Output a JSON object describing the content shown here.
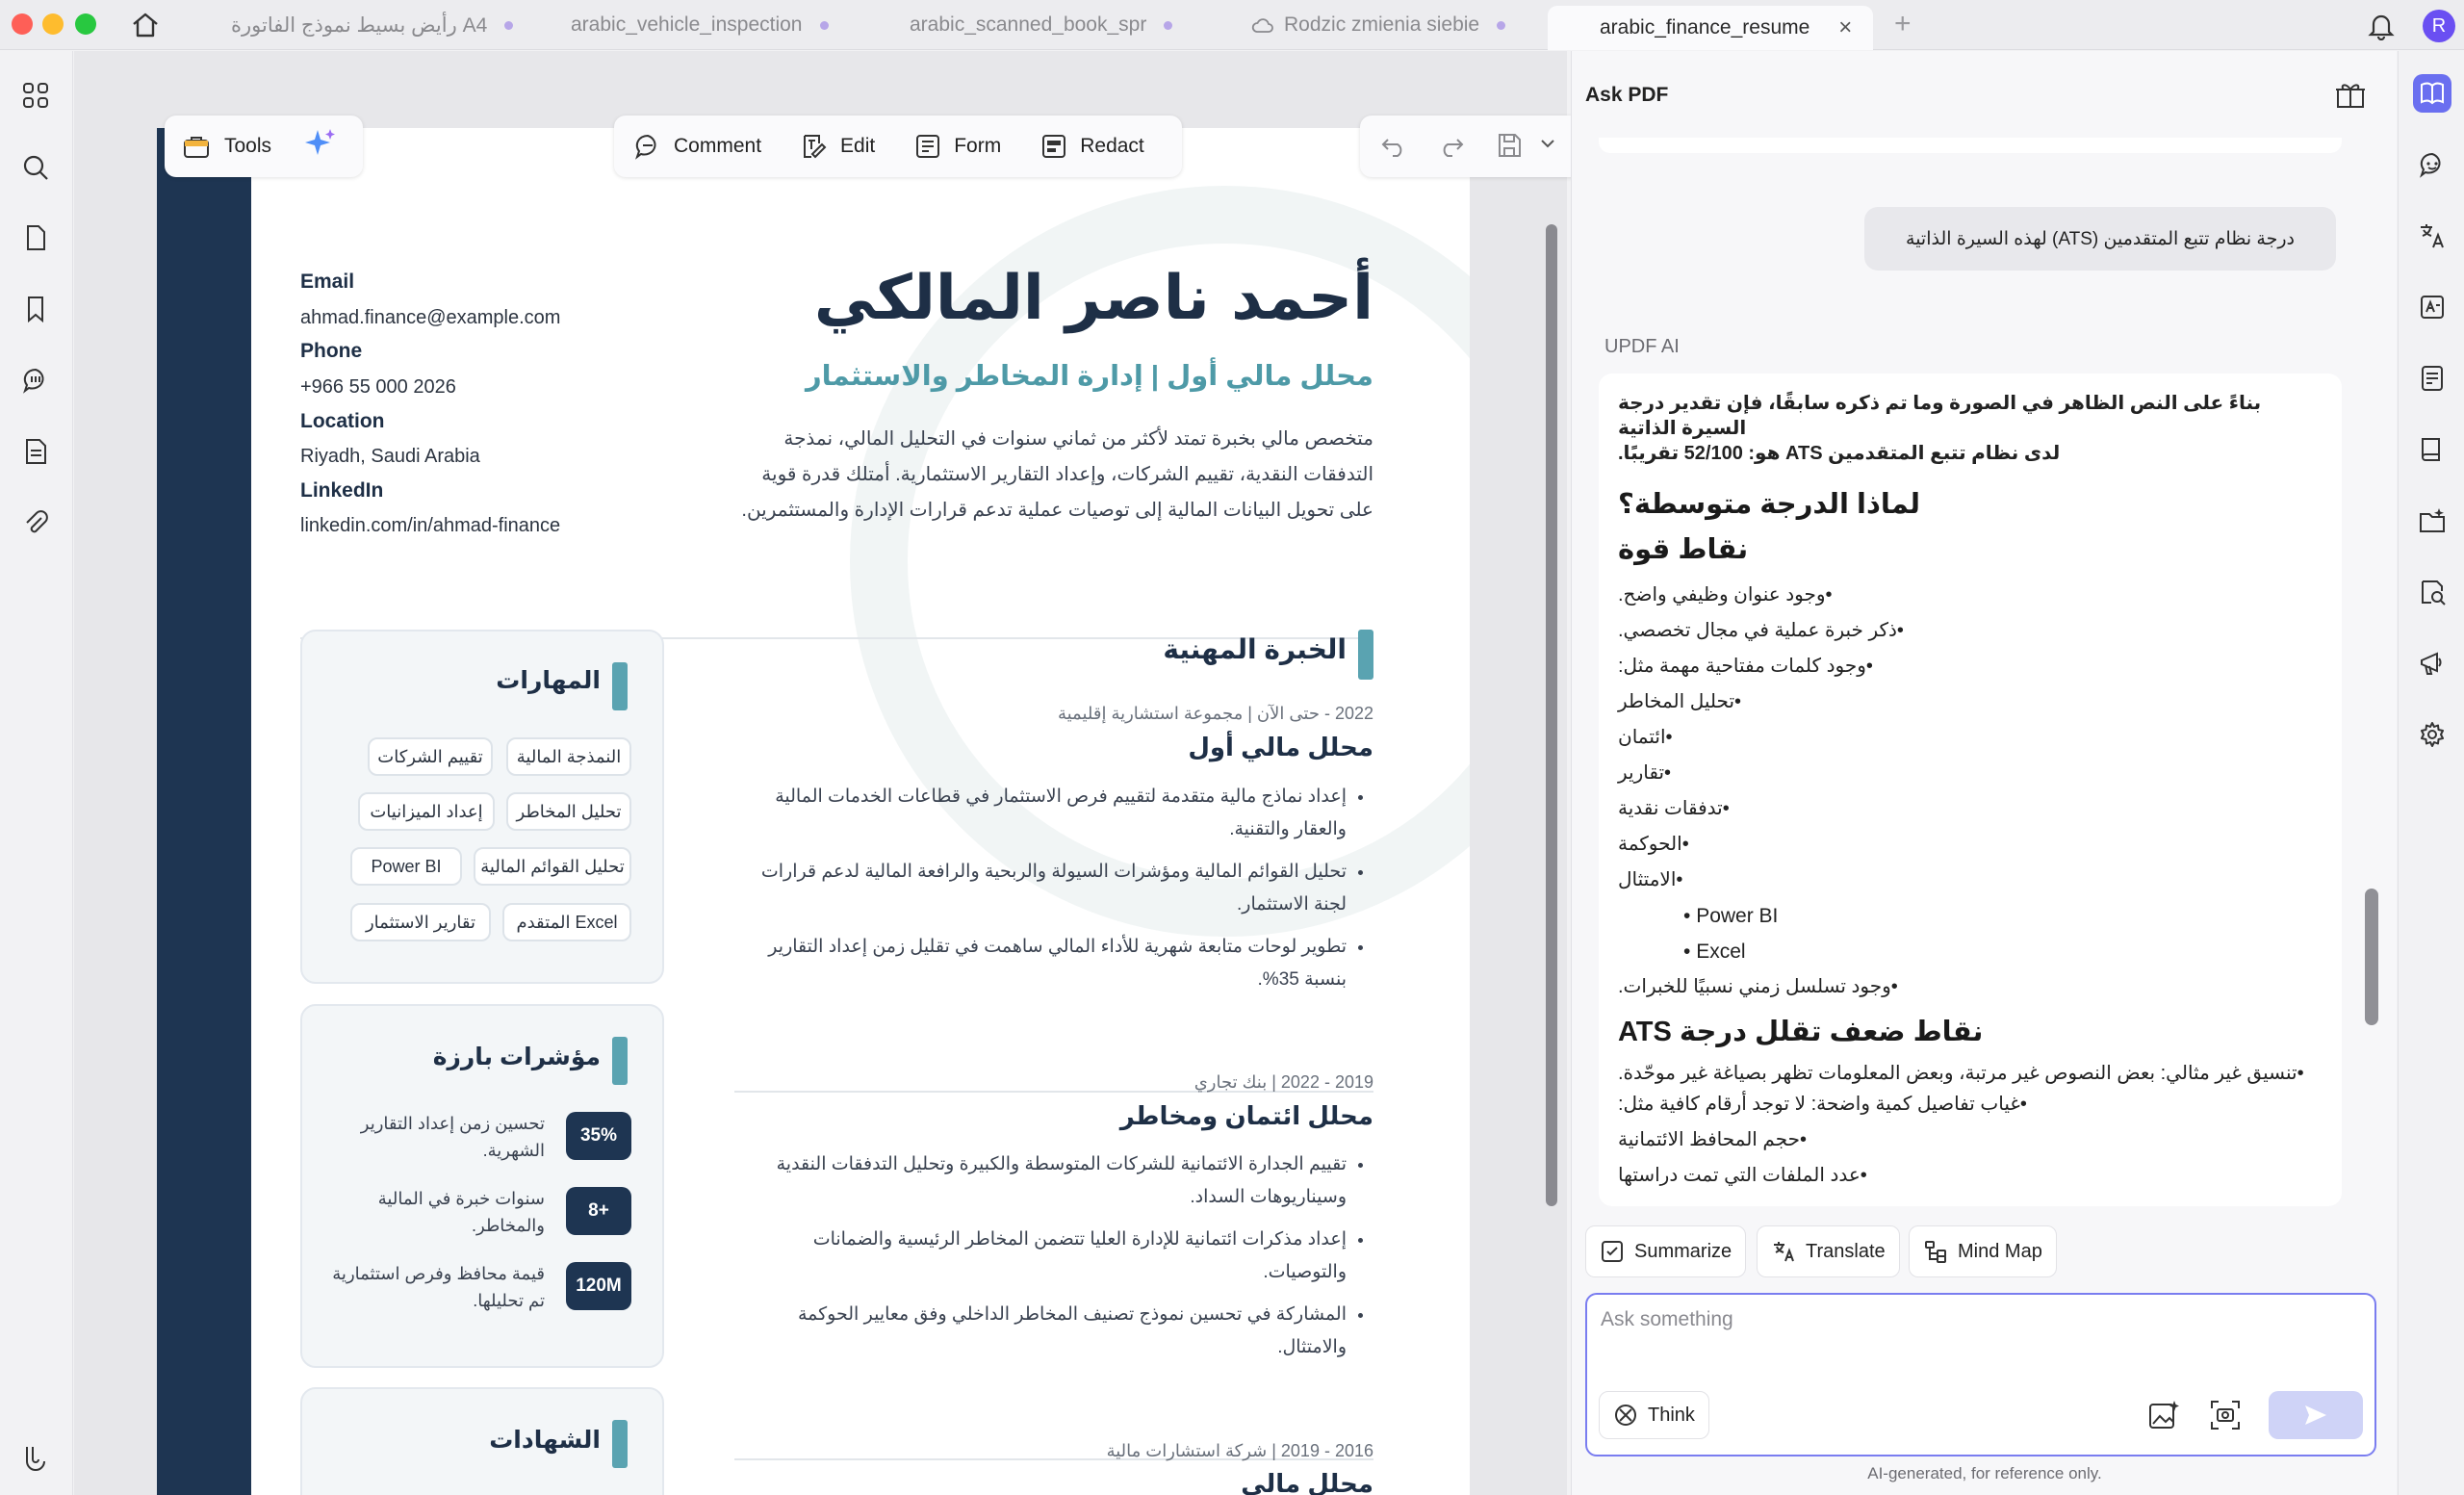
{
  "tabs": [
    {
      "label": "رأيض بسيط نموذج الفاتورة A4",
      "active": false
    },
    {
      "label": "arabic_vehicle_inspection",
      "active": false
    },
    {
      "label": "arabic_scanned_book_spr",
      "active": false
    },
    {
      "label": "Rodzic zmienia siebie",
      "active": false
    },
    {
      "label": "arabic_finance_resume",
      "active": true
    }
  ],
  "user_initial": "R",
  "toolbar": {
    "tools": "Tools",
    "comment": "Comment",
    "edit": "Edit",
    "form": "Form",
    "redact": "Redact"
  },
  "resume": {
    "contact": {
      "email_label": "Email",
      "email": "ahmad.finance@example.com",
      "phone_label": "Phone",
      "phone": "+966 55 000 2026",
      "location_label": "Location",
      "location": "Riyadh, Saudi Arabia",
      "linkedin_label": "LinkedIn",
      "linkedin": "linkedin.com/in/ahmad-finance"
    },
    "name": "أحمد ناصر المالكي",
    "subtitle": "محلل مالي أول | إدارة المخاطر والاستثمار",
    "summary": [
      "متخصص مالي بخبرة تمتد لأكثر من ثماني سنوات في التحليل المالي، نمذجة",
      "التدفقات النقدية، تقييم الشركات، وإعداد التقارير الاستثمارية. أمتلك قدرة قوية",
      "على تحويل البيانات المالية إلى توصيات عملية تدعم قرارات الإدارة والمستثمرين."
    ],
    "experience_title": "الخبرة المهنية",
    "jobs": [
      {
        "meta": "2022 - حتى الآن | مجموعة استشارية إقليمية",
        "title": "محلل مالي أول",
        "bullets": [
          "إعداد نماذج مالية متقدمة لتقييم فرص الاستثمار في قطاعات الخدمات المالية والعقار والتقنية.",
          "تحليل القوائم المالية ومؤشرات السيولة والربحية والرافعة المالية لدعم قرارات لجنة الاستثمار.",
          "تطوير لوحات متابعة شهرية للأداء المالي ساهمت في تقليل زمن إعداد التقارير بنسبة 35%."
        ]
      },
      {
        "meta": "2019 - 2022 | بنك تجاري",
        "title": "محلل ائتمان ومخاطر",
        "bullets": [
          "تقييم الجدارة الائتمانية للشركات المتوسطة والكبيرة وتحليل التدفقات النقدية وسيناريوهات السداد.",
          "إعداد مذكرات ائتمانية للإدارة العليا تتضمن المخاطر الرئيسية والضمانات والتوصيات.",
          "المشاركة في تحسين نموذج تصنيف المخاطر الداخلي وفق معايير الحوكمة والامتثال."
        ]
      },
      {
        "meta": "2016 - 2019 | شركة استشارات مالية",
        "title": "محلل مالي",
        "bullets": []
      }
    ],
    "skills_title": "المهارات",
    "skills": [
      "النمذجة المالية",
      "تقييم الشركات",
      "تحليل المخاطر",
      "إعداد الميزانيات",
      "تحليل القوائم المالية",
      "Power BI",
      "Excel المتقدم",
      "تقارير الاستثمار"
    ],
    "metrics_title": "مؤشرات بارزة",
    "metrics": [
      {
        "value": "35%",
        "label": "تحسين زمن إعداد التقارير الشهرية."
      },
      {
        "value": "8+",
        "label": "سنوات خبرة في المالية والمخاطر."
      },
      {
        "value": "120M",
        "label": "قيمة محافظ وفرص استثمارية تم تحليلها."
      }
    ],
    "certs_title": "الشهادات"
  },
  "ask_pdf": {
    "title": "Ask PDF",
    "user_message": "درجة نظام تتبع المتقدمين (ATS) لهذه السيرة الذاتية",
    "ai_label": "UPDF AI",
    "intro_line1": "بناءً على النص الظاهر في الصورة وما تم ذكره سابقًا، فإن تقدير درجة السيرة الذاتية",
    "intro_line2": "لدى نظام تتبع المتقدمين ATS هو: 52/100 تقريبًا.",
    "why_heading": "لماذا الدرجة متوسطة؟",
    "strengths_heading": "نقاط قوة",
    "strengths": [
      "•وجود عنوان وظيفي واضح.",
      "•ذكر خبرة عملية في مجال تخصصي.",
      "•وجود كلمات مفتاحية مهمة مثل:",
      "•تحليل المخاطر",
      "•ائتمان",
      "•تقارير",
      "•تدفقات نقدية",
      "•الحوكمة",
      "•الامتثال"
    ],
    "strengths_sub": [
      "Power BI",
      "Excel"
    ],
    "strengths_last": "•وجود تسلسل زمني نسبيًا للخبرات.",
    "weak_heading": "نقاط ضعف تقلل درجة ATS",
    "weak": [
      "•تنسيق غير مثالي: بعض النصوص غير مرتبة، وبعض المعلومات تظهر بصياغة غير موحّدة.",
      "•غياب تفاصيل كمية واضحة: لا توجد أرقام كافية مثل:",
      "•حجم المحافظ الائتمانية",
      "•عدد الملفات التي تمت دراستها"
    ],
    "quick_actions": [
      "Summarize",
      "Translate",
      "Mind Map"
    ],
    "input_placeholder": "Ask something",
    "think_label": "Think",
    "disclaimer": "AI-generated, for reference only."
  }
}
